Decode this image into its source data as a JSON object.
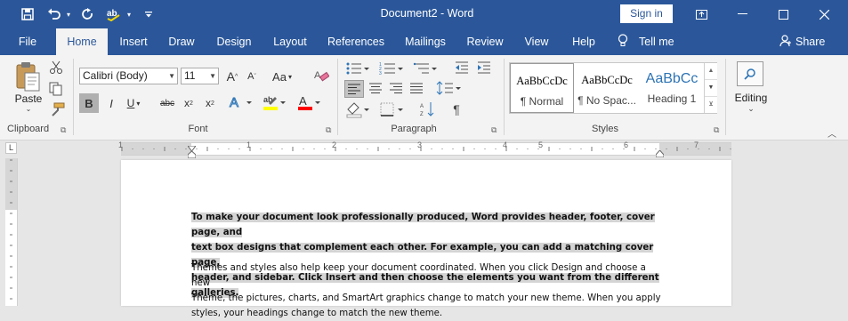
{
  "window": {
    "title": "Document2  -  Word",
    "signin": "Sign in"
  },
  "qat": {
    "save": "save-icon",
    "undo": "undo-icon",
    "redo": "redo-icon",
    "spell": "spelling-icon",
    "customize": "customize-qat-icon"
  },
  "tabs": [
    {
      "label": "File"
    },
    {
      "label": "Home"
    },
    {
      "label": "Insert"
    },
    {
      "label": "Draw"
    },
    {
      "label": "Design"
    },
    {
      "label": "Layout"
    },
    {
      "label": "References"
    },
    {
      "label": "Mailings"
    },
    {
      "label": "Review"
    },
    {
      "label": "View"
    },
    {
      "label": "Help"
    }
  ],
  "tellme": "Tell me",
  "share": "Share",
  "clipboard": {
    "paste": "Paste",
    "label": "Clipboard"
  },
  "font": {
    "name": "Calibri (Body)",
    "size": "11",
    "label": "Font",
    "change_case": "Aa",
    "bold": "B",
    "italic": "I",
    "underline": "U",
    "strike": "abc",
    "sub": "x",
    "sub_mark": "2",
    "sup": "x",
    "sup_mark": "2",
    "grow": "A",
    "shrink": "A",
    "effects": "A",
    "color": "A",
    "highlight_color": "#ffff00",
    "font_color": "#ff0000"
  },
  "paragraph": {
    "label": "Paragraph"
  },
  "styles": {
    "label": "Styles",
    "items": [
      {
        "preview": "AaBbCcDc",
        "name": "¶ Normal"
      },
      {
        "preview": "AaBbCcDc",
        "name": "¶ No Spac..."
      },
      {
        "preview": "AaBbCc",
        "name": "Heading 1"
      }
    ]
  },
  "editing": {
    "label": "Editing"
  },
  "ruler": {
    "numbers": [
      "1",
      "1",
      "2",
      "3",
      "4",
      "5",
      "6",
      "7"
    ]
  },
  "document": {
    "p1": "To make your document look professionally produced, Word provides header, footer, cover page, and text box designs that complement each other. For example, you can add a matching cover page, header, and sidebar. Click Insert and then choose the elements you want from the different galleries.",
    "p1_lines": [
      "To make your document look professionally produced, Word provides header, footer, cover page, and",
      "text box designs that complement each other. For example, you can add a matching cover page,",
      "header, and sidebar. Click Insert and then choose the elements you want from the different galleries."
    ],
    "p2_lines": [
      "Themes and styles also help keep your document coordinated. When you click Design and choose a new",
      "Theme, the pictures, charts, and SmartArt graphics change to match your new theme. When you apply",
      "styles, your headings change to match the new theme."
    ]
  }
}
